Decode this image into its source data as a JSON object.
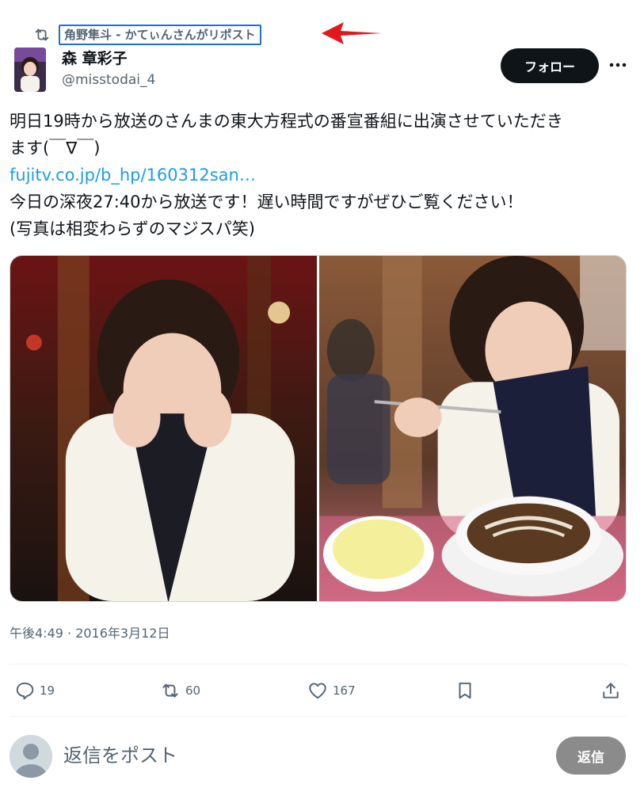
{
  "repost": {
    "icon": "repost-icon",
    "label": "角野隼斗 - かてぃんさんがリポスト"
  },
  "author": {
    "display_name": "森 章彩子",
    "handle": "@misstodai_4"
  },
  "follow_label": "フォロー",
  "more_icon": "more-icon",
  "tweet": {
    "line1": "明日19時から放送のさんまの東大方程式の番宣番組に出演させていただき",
    "line2": "ます(￣∇￣)",
    "link": "fujitv.co.jp/b_hp/160312san…",
    "line3": "今日の深夜27:40から放送です！遅い時間ですがぜひご覧ください！",
    "line4": "(写真は相変わらずのマジスパ笑)"
  },
  "timestamp": "午後4:49 · 2016年3月12日",
  "actions": {
    "replies": "19",
    "reposts": "60",
    "likes": "167"
  },
  "reply": {
    "placeholder": "返信をポスト",
    "button_label": "返信"
  },
  "colors": {
    "accent": "#1d9bf0",
    "text": "#0f1419",
    "secondary": "#536471",
    "highlight_box": "#1d6fd6",
    "arrow": "#e0191e"
  }
}
